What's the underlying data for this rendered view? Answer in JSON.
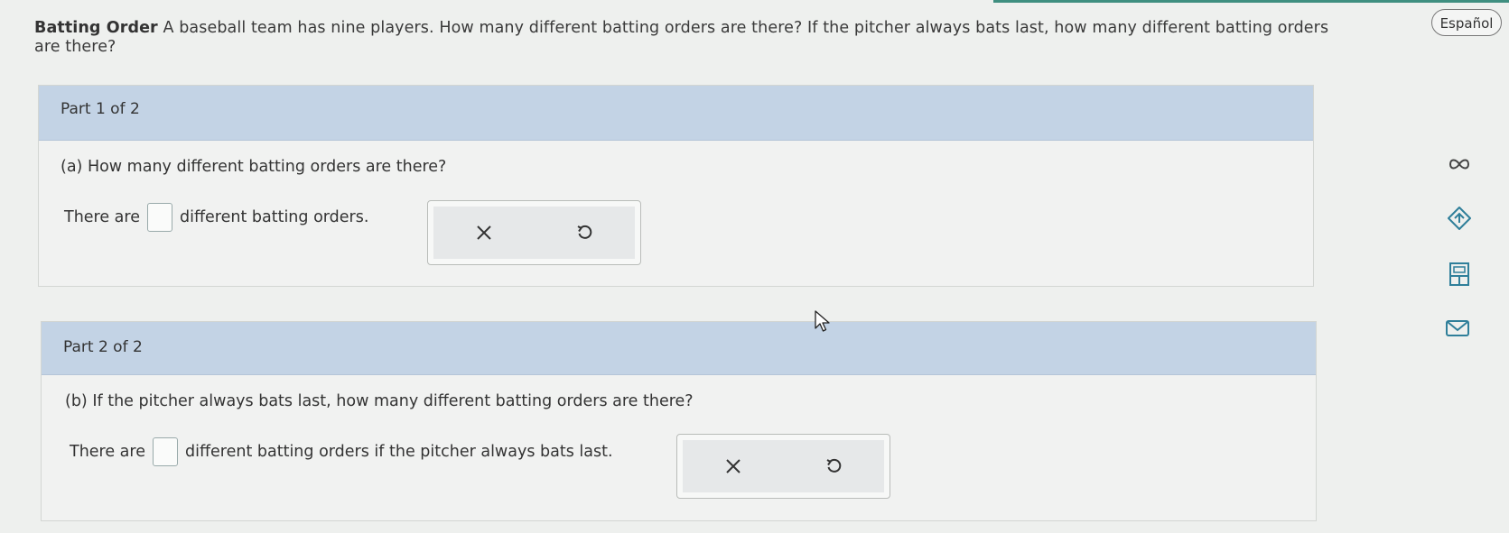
{
  "problem": {
    "title": "Batting Order",
    "text": "A baseball team has nine players. How many different batting orders are there? If the pitcher always bats last, how many different batting orders are there?"
  },
  "language_button": "Español",
  "part1": {
    "header": "Part 1 of 2",
    "question": "(a) How many different batting orders are there?",
    "answer_prefix": "There are",
    "answer_value": "",
    "answer_suffix": "different batting orders."
  },
  "part2": {
    "header": "Part 2 of 2",
    "question": "(b) If the pitcher always bats last, how many different batting orders are there?",
    "answer_prefix": "There are",
    "answer_value": "",
    "answer_suffix": "different batting orders if the pitcher always bats last."
  },
  "tools": {
    "clear_icon": "close-icon",
    "undo_icon": "undo-icon"
  },
  "sidebar": [
    "infinity-icon",
    "tag-icon",
    "calculator-icon",
    "mail-icon"
  ],
  "colors": {
    "header_bg": "#c3d3e5",
    "accent": "#3f8f80"
  }
}
